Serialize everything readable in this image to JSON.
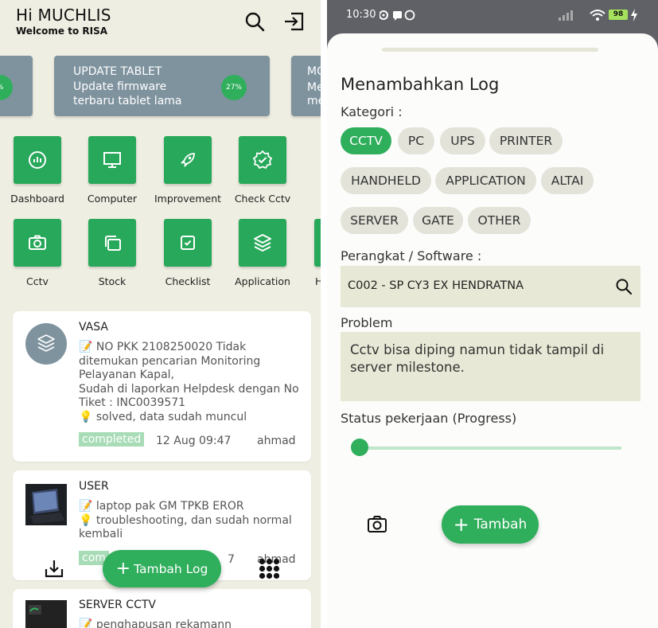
{
  "left": {
    "greeting": "Hi MUCHLIS",
    "welcome": "Welcome to RISA",
    "banners": [
      {
        "title": "UPDATE TABLET",
        "desc": "Update firmware terbaru tablet lama",
        "progress": "27%"
      }
    ],
    "banner_left_partial_pct": "%",
    "banner_right_partial": {
      "line1": "MO",
      "line2": "Me",
      "line3": "me"
    },
    "menu": [
      {
        "label": "Dashboard",
        "icon": "chart-circle-icon"
      },
      {
        "label": "Computer",
        "icon": "monitor-icon"
      },
      {
        "label": "Improvement",
        "icon": "rocket-icon"
      },
      {
        "label": "Check Cctv",
        "icon": "verified-badge-icon"
      },
      {
        "label": "Cctv",
        "icon": "camera-icon"
      },
      {
        "label": "Stock",
        "icon": "layers-box-icon"
      },
      {
        "label": "Checklist",
        "icon": "checkbox-icon"
      },
      {
        "label": "Application",
        "icon": "stack-icon"
      },
      {
        "label": "H",
        "icon": "partial-icon"
      }
    ],
    "logs": [
      {
        "title": "VASA",
        "lines": [
          "📝 NO PKK 2108250020 Tidak ditemukan pencarian Monitoring Pelayanan Kapal,",
          "Sudah di laporkan Helpdesk dengan No Tiket : INC0039571",
          "💡 solved, data sudah muncul"
        ],
        "status": "completed",
        "date": "12 Aug 09:47",
        "user": "ahmad"
      },
      {
        "title": "USER",
        "lines": [
          "📝 laptop pak GM TPKB EROR",
          "💡 troubleshooting, dan sudah normal kembali"
        ],
        "status": "com",
        "date": "7",
        "user": "ahmad"
      },
      {
        "title": "SERVER CCTV",
        "lines": [
          "📝 penghapusan rekamann"
        ],
        "status": "",
        "date": "",
        "user": ""
      }
    ],
    "fab_label": "Tambah Log",
    "fab_plus": "+"
  },
  "right": {
    "status": {
      "time": "10:30",
      "battery": "98"
    },
    "title": "Menambahkan Log",
    "kategori_label": "Kategori :",
    "categories": [
      "CCTV",
      "PC",
      "UPS",
      "PRINTER",
      "HANDHELD",
      "APPLICATION",
      "ALTAI",
      "SERVER",
      "GATE",
      "OTHER"
    ],
    "selected_category": "CCTV",
    "device_label": "Perangkat / Software :",
    "device_value": "C002 - SP CY3 EX HENDRATNA",
    "problem_label": "Problem",
    "problem_value": "Cctv bisa diping namun tidak tampil di server milestone.",
    "progress_label": "Status pekerjaan (Progress)",
    "progress_value": 0,
    "add_button": "Tambah",
    "add_plus": "+"
  },
  "colors": {
    "accent": "#2fae5c",
    "left_bg": "#eeeee2",
    "banner": "#7f939f",
    "field_bg": "#e8e8d6",
    "chip_bg": "#e3e3da"
  }
}
